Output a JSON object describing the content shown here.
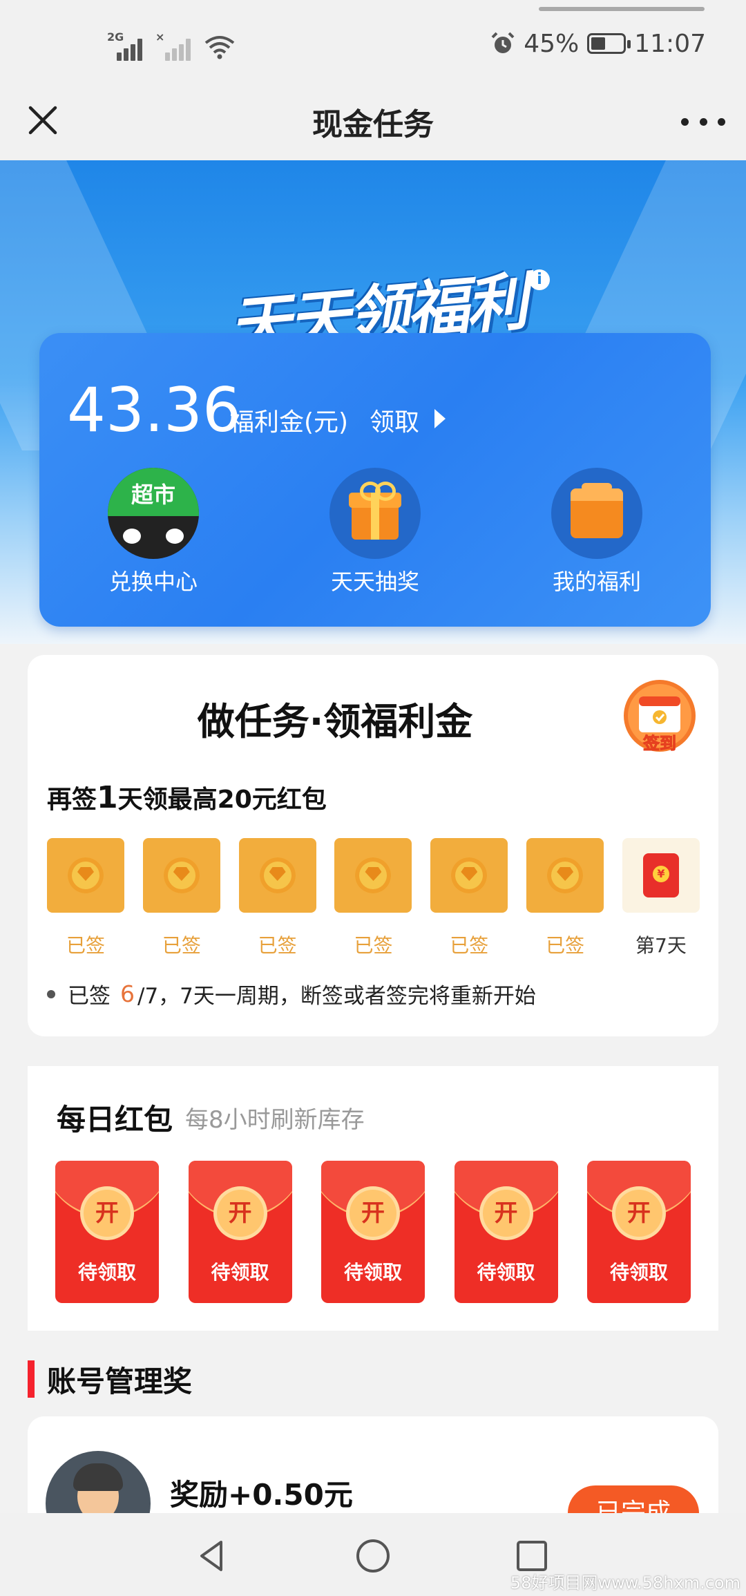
{
  "status_bar": {
    "network_tag": "2G",
    "battery_percent": "45%",
    "battery_level": 0.45,
    "time": "11:07"
  },
  "title_bar": {
    "title": "现金任务"
  },
  "hero": {
    "slogan": "天天领福利",
    "info_glyph": "i",
    "amount": "43.36",
    "unit": "福利金(元)",
    "claim_label": "领取",
    "shortcuts": [
      {
        "label": "兑换中心",
        "badge": "超市"
      },
      {
        "label": "天天抽奖"
      },
      {
        "label": "我的福利"
      }
    ]
  },
  "checkin": {
    "heading": "做任务·领福利金",
    "badge_label": "签到",
    "sub_prefix": "再签",
    "sub_days": "1",
    "sub_suffix": "天领最高20元红包",
    "days": [
      {
        "label": "已签",
        "signed": true
      },
      {
        "label": "已签",
        "signed": true
      },
      {
        "label": "已签",
        "signed": true
      },
      {
        "label": "已签",
        "signed": true
      },
      {
        "label": "已签",
        "signed": true
      },
      {
        "label": "已签",
        "signed": true
      },
      {
        "label": "第7天",
        "signed": false
      }
    ],
    "note_prefix": "已签",
    "note_count": "6",
    "note_rest": "/7，7天一周期，断签或者签完将重新开始"
  },
  "daily_packets": {
    "title": "每日红包",
    "subtitle": "每8小时刷新库存",
    "packets": [
      {
        "open_label": "开",
        "status": "待领取"
      },
      {
        "open_label": "开",
        "status": "待领取"
      },
      {
        "open_label": "开",
        "status": "待领取"
      },
      {
        "open_label": "开",
        "status": "待领取"
      },
      {
        "open_label": "开",
        "status": "待领取"
      }
    ]
  },
  "account": {
    "section_title": "账号管理奖",
    "reward": "奖励+0.50元",
    "button": "已完成"
  },
  "watermark": "58好项目网www.58hxm.com",
  "colors": {
    "accent_blue": "#2a7ff2",
    "signed_orange": "#f2ad3d",
    "packet_red": "#ee2e26",
    "done_orange": "#f45a25"
  }
}
